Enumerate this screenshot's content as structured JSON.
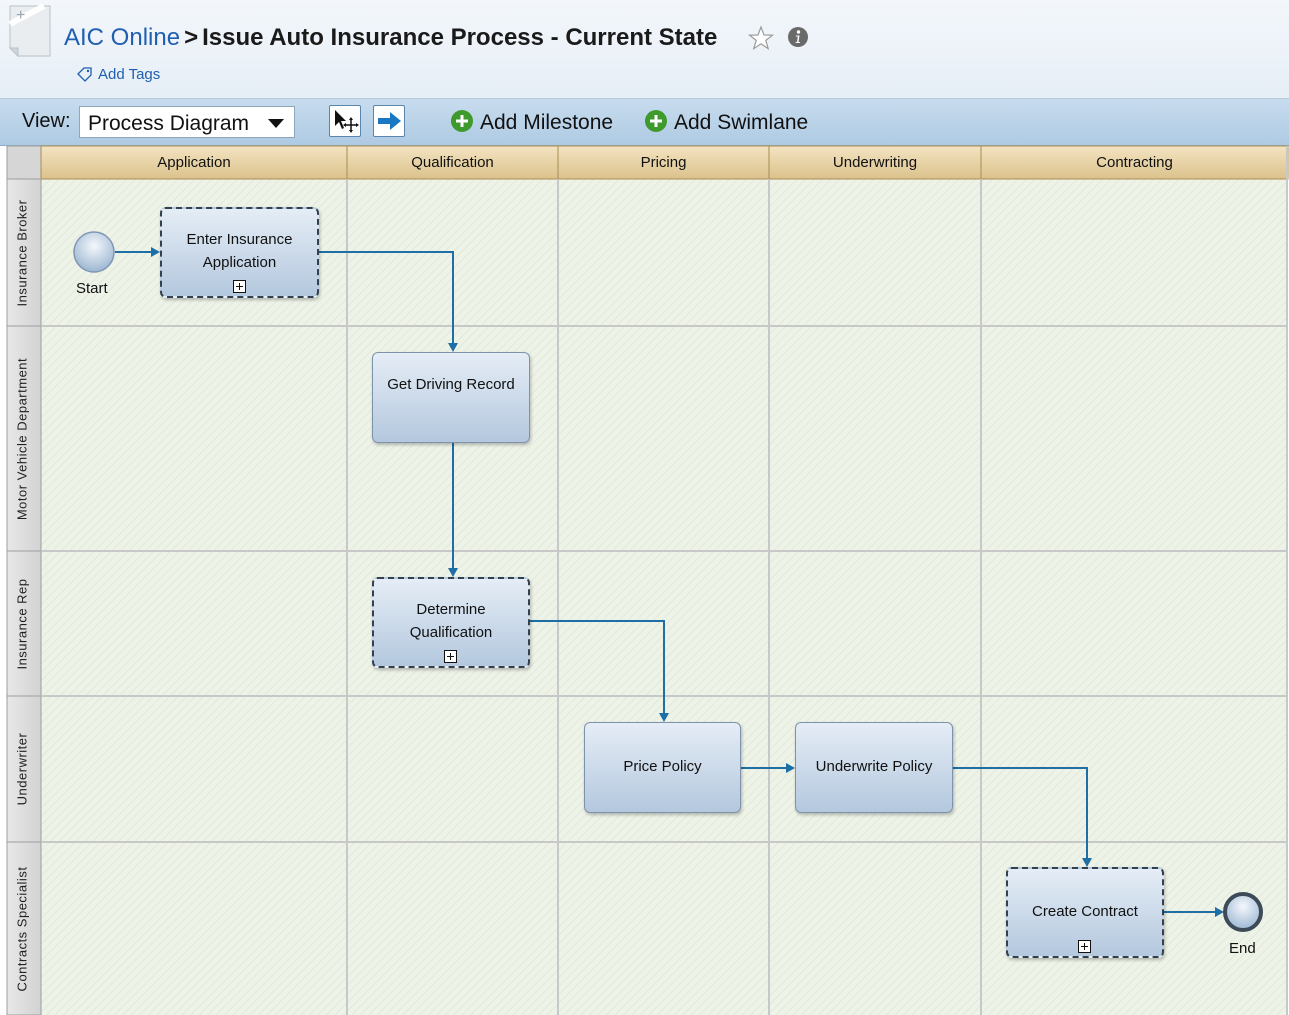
{
  "header": {
    "breadcrumb_link": "AIC Online",
    "separator": ">",
    "title": "Issue Auto Insurance Process - Current State",
    "add_tags": "Add Tags"
  },
  "toolbar": {
    "view_label": "View:",
    "view_value": "Process Diagram",
    "add_milestone": "Add Milestone",
    "add_swimlane": "Add Swimlane"
  },
  "milestones": [
    "Application",
    "Qualification",
    "Pricing",
    "Underwriting",
    "Contracting"
  ],
  "swimlanes": [
    "Insurance Broker",
    "Motor Vehicle Department",
    "Insurance Rep",
    "Underwriter",
    "Contracts Specialist"
  ],
  "events": {
    "start": "Start",
    "end": "End"
  },
  "tasks": {
    "enter_application": "Enter Insurance Application",
    "get_driving_record": "Get Driving Record",
    "determine_qualification": "Determine Qualification",
    "price_policy": "Price Policy",
    "underwrite_policy": "Underwrite Policy",
    "create_contract": "Create Contract"
  },
  "colors": {
    "grid_bg": "#eef3e8",
    "milestone_header": "#e7d4a8",
    "connector": "#1d6fa5",
    "task_fill": "#c8d7e8",
    "link": "#1f5fb0"
  }
}
